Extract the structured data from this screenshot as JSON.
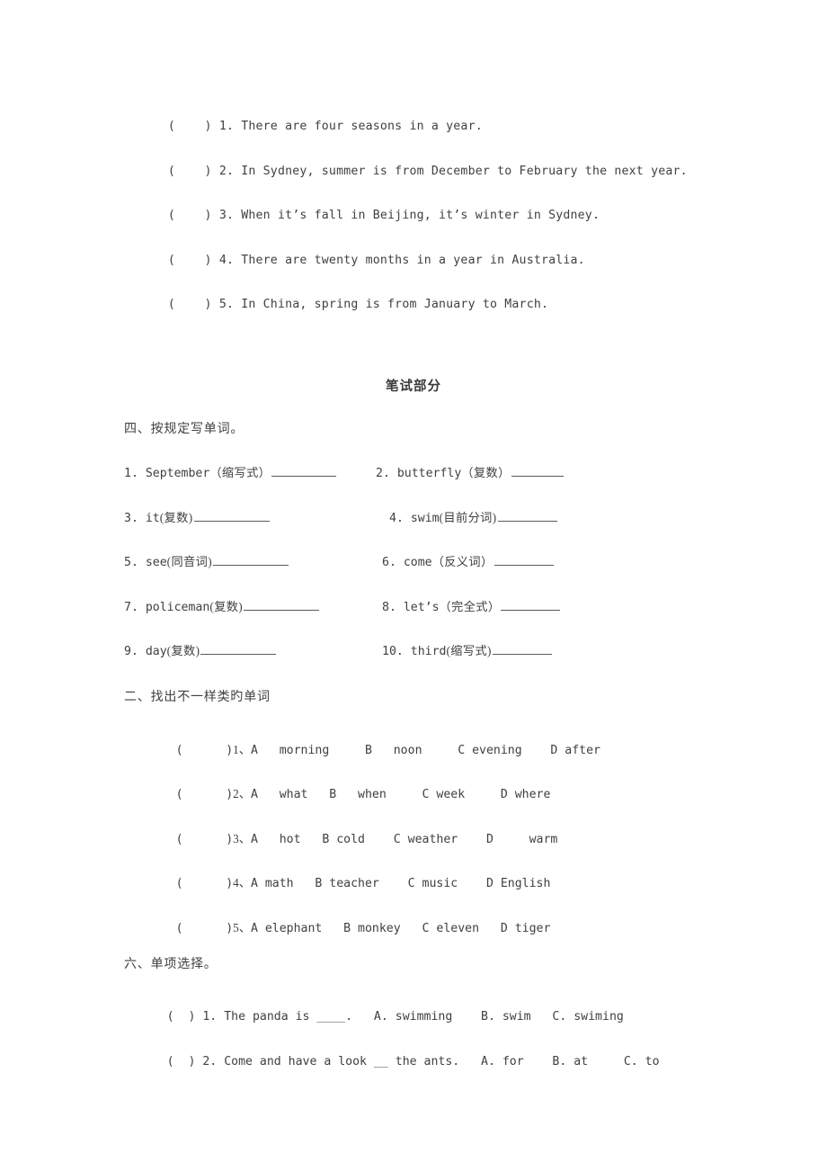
{
  "document": {
    "background_color": "#ffffff",
    "text_color": "#404040",
    "rule_color": "#5a5a5a"
  },
  "true_false_section": {
    "items": [
      {
        "bracket": "(    )",
        "number": "1.",
        "text": "There are four seasons in a year."
      },
      {
        "bracket": "(    )",
        "number": "2.",
        "text": "In Sydney, summer is from December to February the next year."
      },
      {
        "bracket": "(    )",
        "number": "3.",
        "text": "When it’s fall in Beijing, it’s winter in Sydney."
      },
      {
        "bracket": "(    )",
        "number": "4.",
        "text": "There are twenty months in a year in Australia."
      },
      {
        "bracket": "(    )",
        "number": "5.",
        "text": "In China, spring is from January to March."
      }
    ]
  },
  "written_part": {
    "heading": "笔试部分"
  },
  "word_forms_section": {
    "heading": "四、按规定写单词。",
    "items": [
      {
        "number": "1.",
        "word": "September",
        "hint": "（缩写式）",
        "blank_width": 72
      },
      {
        "number": "2.",
        "word": "butterfly",
        "hint": "（复数）",
        "blank_width": 58
      },
      {
        "number": "3.",
        "word": "it",
        "hint": "(复数)",
        "blank_width": 84
      },
      {
        "number": "4.",
        "word": "swim",
        "hint": "(目前分词)",
        "blank_width": 66
      },
      {
        "number": "5.",
        "word": "see",
        "hint": "(同音词)",
        "blank_width": 84
      },
      {
        "number": "6.",
        "word": "come",
        "hint": "（反义词）",
        "blank_width": 66
      },
      {
        "number": "7.",
        "word": "policeman",
        "hint": "(复数)",
        "blank_width": 84
      },
      {
        "number": "8.",
        "word": "let’s",
        "hint": "（完全式）",
        "blank_width": 66
      },
      {
        "number": "9.",
        "word": "day",
        "hint": "(复数)",
        "blank_width": 84
      },
      {
        "number": "10.",
        "word": "third",
        "hint": "(缩写式)",
        "blank_width": 66
      }
    ]
  },
  "odd_one_out_section": {
    "heading": "二、找出不一样类旳单词",
    "items": [
      {
        "bracket": "(      )",
        "number": "1、",
        "options": "A   morning     B   noon     C evening    D after"
      },
      {
        "bracket": "(      )",
        "number": "2、",
        "options": "A   what   B   when     C week     D where"
      },
      {
        "bracket": "(      )",
        "number": "3、",
        "options": "A   hot   B cold    C weather    D     warm"
      },
      {
        "bracket": "(      )",
        "number": "4、",
        "options": "A math   B teacher    C music    D English"
      },
      {
        "bracket": "(      )",
        "number": "5、",
        "options": "A elephant   B monkey   C eleven   D tiger"
      }
    ]
  },
  "single_choice_section": {
    "heading": "六、单项选择。",
    "items": [
      {
        "bracket": "(  )",
        "number": "1.",
        "text": "The panda is ____.   A. swimming    B. swim   C. swiming"
      },
      {
        "bracket": "(  )",
        "number": "2.",
        "text": "Come and have a look __ the ants.   A. for    B. at     C. to"
      }
    ]
  }
}
